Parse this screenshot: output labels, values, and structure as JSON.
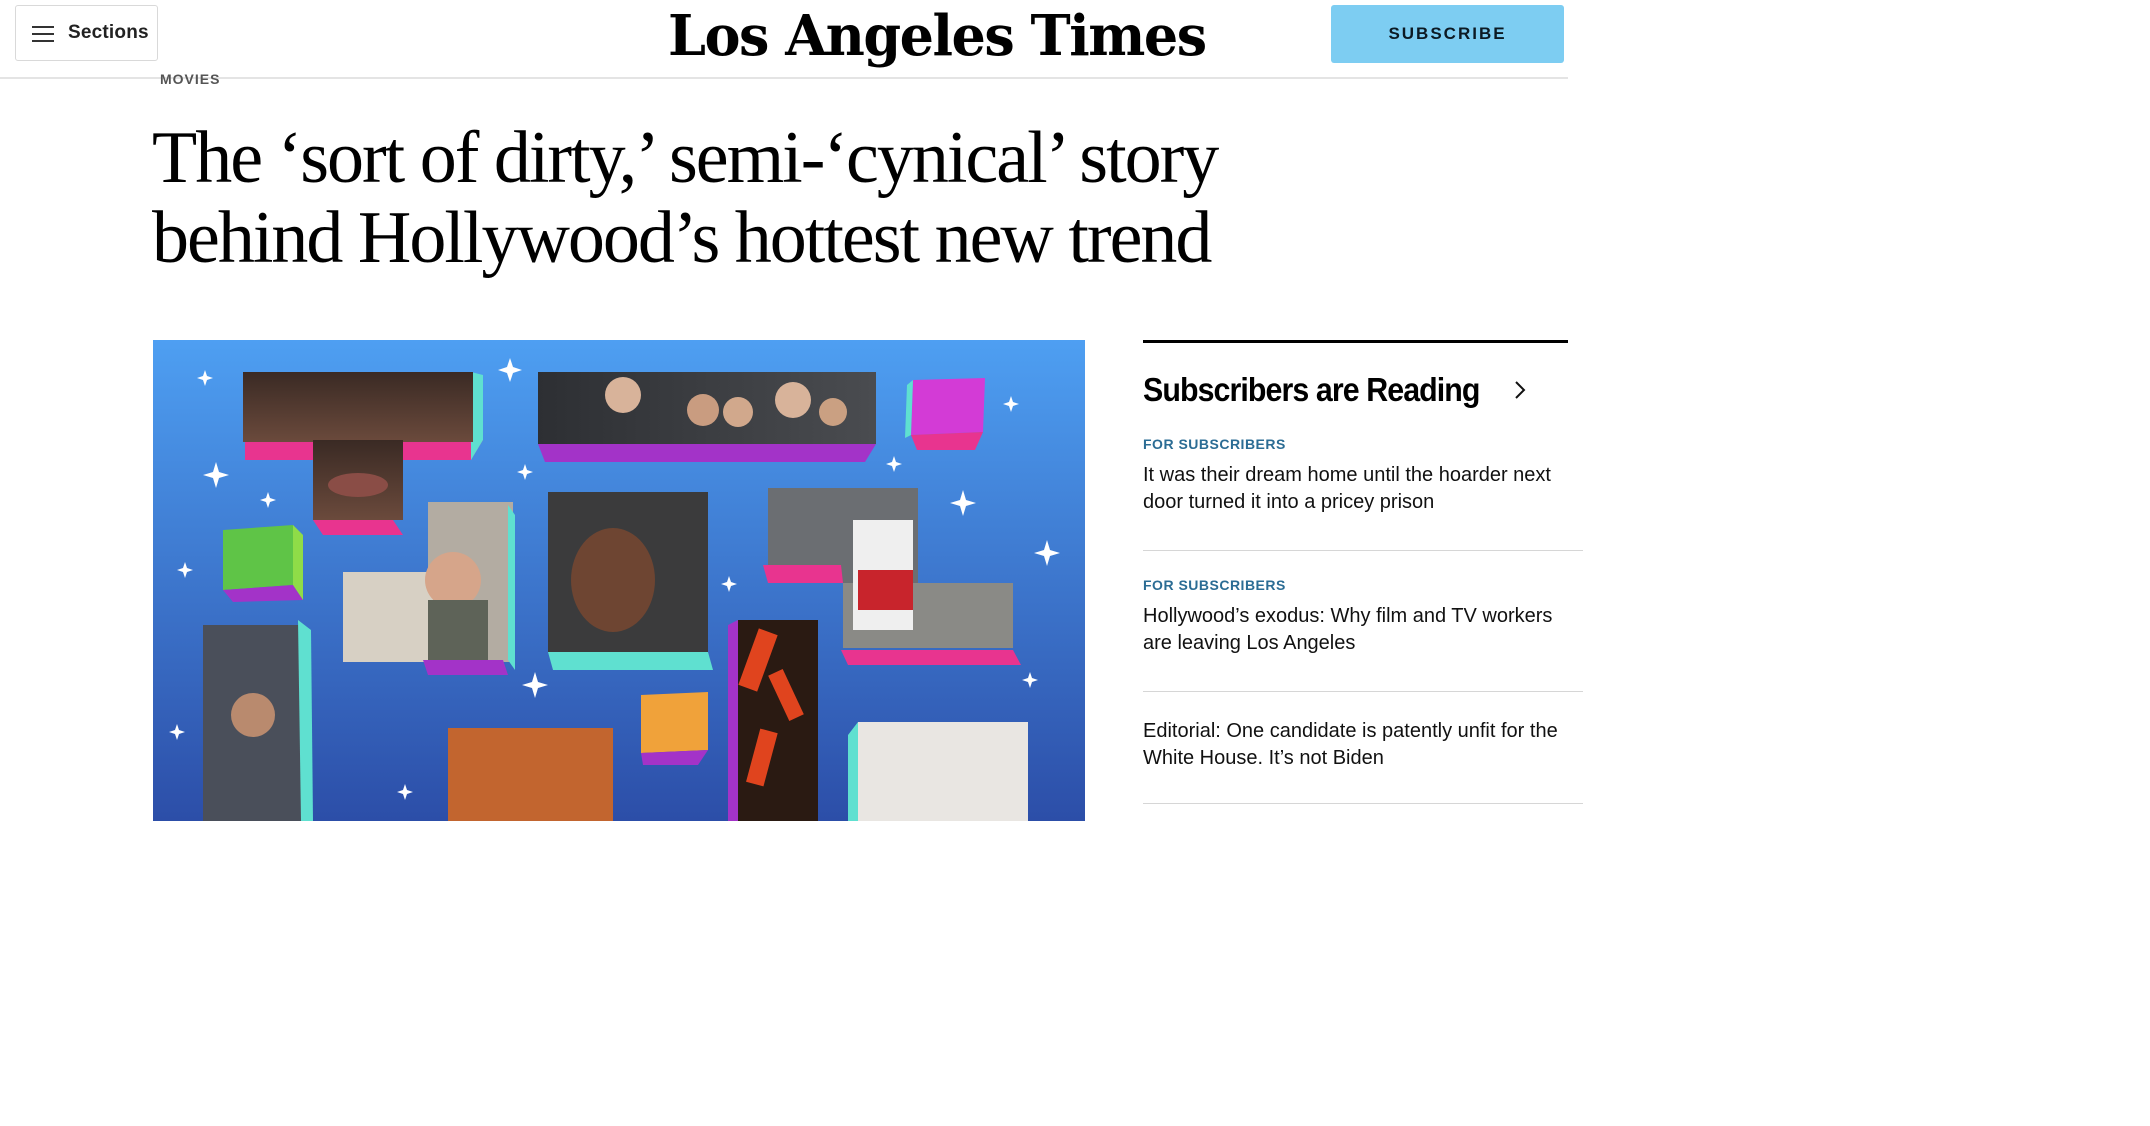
{
  "header": {
    "sections_label": "Sections",
    "logo_text": "Los Angeles Times",
    "subscribe_label": "SUBSCRIBE",
    "subscribe_color": "#7dcdf2"
  },
  "article": {
    "kicker": "MOVIES",
    "headline": "The ‘sort of dirty,’ semi-‘cynical’ story behind Hollywood’s hottest new trend",
    "hero_image": "collage-of-movie-stills",
    "hero_bg_colors": [
      "#4a9cf0",
      "#2f4fae"
    ]
  },
  "rail": {
    "title": "Subscribers are Reading",
    "stories": [
      {
        "label": "FOR SUBSCRIBERS",
        "headline": "It was their dream home until the hoarder next door turned it into a pricey prison"
      },
      {
        "label": "FOR SUBSCRIBERS",
        "headline": "Hollywood’s exodus: Why film and TV workers are leaving Los Angeles"
      },
      {
        "label": "",
        "headline": "Editorial: One candidate is patently unfit for the White House. It’s not Biden"
      }
    ]
  },
  "icons": {
    "menu": "hamburger-menu-icon",
    "chevron": "chevron-right-icon",
    "sparkle": "sparkle-icon"
  }
}
